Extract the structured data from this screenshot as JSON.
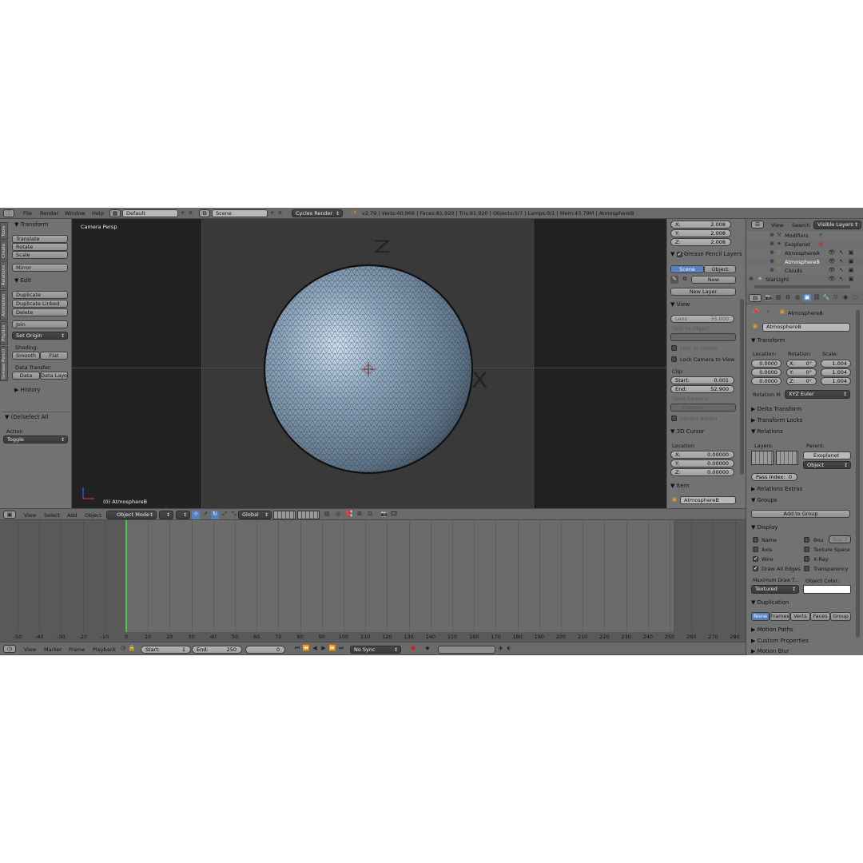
{
  "topbar": {
    "menus": [
      "File",
      "Render",
      "Window",
      "Help"
    ],
    "layout": "Default",
    "scene": "Scene",
    "engine": "Cycles Render",
    "stats": "v2.79 | Verts:40,968 | Faces:81,920 | Tris:81,920 | Objects:0/7 | Lamps:0/1 | Mem:43.79M | AtmosphereB"
  },
  "toolshelf": {
    "tabs": [
      "Tools",
      "Create",
      "Relations",
      "Animation",
      "Physics",
      "Grease Pencil"
    ],
    "transform_title": "Transform",
    "translate": "Translate",
    "rotate": "Rotate",
    "scale": "Scale",
    "mirror": "Mirror",
    "edit_title": "Edit",
    "duplicate": "Duplicate",
    "duplicate_linked": "Duplicate Linked",
    "delete": "Delete",
    "join": "Join",
    "set_origin": "Set Origin",
    "shading_label": "Shading:",
    "smooth": "Smooth",
    "flat": "Flat",
    "data_transfer_label": "Data Transfer:",
    "data": "Data",
    "data_layout": "Data Layo",
    "history": "History",
    "operator_title": "(De)select All",
    "action_label": "Action",
    "action_value": "Toggle"
  },
  "viewport": {
    "label": "Camera Persp",
    "object_label": "(0) AtmosphereB",
    "axis_z": "Z",
    "axis_x": "X"
  },
  "npanel": {
    "loc_x_label": "X:",
    "loc_x": "2.008",
    "loc_y_label": "Y:",
    "loc_y": "2.008",
    "loc_z_label": "Z:",
    "loc_z": "2.008",
    "grease_pencil_title": "Grease Pencil Layers",
    "scene_tab": "Scene",
    "object_tab": "Object",
    "new": "New",
    "new_layer": "New Layer",
    "view_title": "View",
    "lens_label": "Lens",
    "lens": "35.000",
    "lock_to_object": "Lock to Object:",
    "lock_to_cursor": "Lock to Cursor",
    "lock_camera": "Lock Camera to View",
    "clip_label": "Clip:",
    "clip_start_label": "Start:",
    "clip_start": "0.001",
    "clip_end_label": "End:",
    "clip_end": "52.900",
    "local_camera": "Local Camera:",
    "camera": "Camera",
    "render_border": "Render Border",
    "cursor_title": "3D Cursor",
    "location_label": "Location:",
    "cur_x_label": "X:",
    "cur_x": "0.00000",
    "cur_y_label": "Y:",
    "cur_y": "0.00000",
    "cur_z_label": "Z:",
    "cur_z": "0.00000",
    "item_title": "Item",
    "item_name": "AtmosphereB"
  },
  "outliner": {
    "view": "View",
    "search": "Search",
    "filter": "Visible Layers",
    "items": [
      "Modifiers",
      "Exoplanet",
      "AtmosphereA",
      "AtmosphereB",
      "Clouds",
      "StarLight"
    ]
  },
  "properties": {
    "breadcrumb": "AtmosphereB",
    "object_name": "AtmosphereB",
    "transform_title": "Transform",
    "location_label": "Location:",
    "rotation_label": "Rotation:",
    "scale_label": "Scale:",
    "loc": [
      "0.0000",
      "0.0000",
      "0.0000"
    ],
    "rot": [
      "0°",
      "0°",
      "0°"
    ],
    "scl": [
      "1.004",
      "1.004",
      "1.004"
    ],
    "axes": [
      "X:",
      "Y:",
      "Z:"
    ],
    "rotation_mode_label": "Rotation M",
    "rotation_mode": "XYZ Euler",
    "delta_transform": "Delta Transform",
    "transform_locks": "Transform Locks",
    "relations": "Relations",
    "layers_label": "Layers:",
    "parent_label": "Parent:",
    "parent": "Exoplanet",
    "parent_type": "Object",
    "pass_index_label": "Pass Index:",
    "pass_index": "0",
    "relations_extras": "Relations Extras",
    "groups": "Groups",
    "add_to_group": "Add to Group",
    "display": "Display",
    "name": "Name",
    "bounds": "Bou",
    "bounds_type": "Box",
    "axis": "Axis",
    "texture_space": "Texture Space",
    "wire": "Wire",
    "xray": "X-Ray",
    "draw_all_edges": "Draw All Edges",
    "transparency": "Transparency",
    "max_draw_type_label": "Maximum Draw T...",
    "object_color_label": "Object Color:",
    "max_draw_type": "Textured",
    "duplication": "Duplication",
    "dup_options": [
      "None",
      "Frames",
      "Verts",
      "Faces",
      "Group"
    ],
    "motion_paths": "Motion Paths",
    "custom_properties": "Custom Properties",
    "motion_blur": "Motion Blur"
  },
  "view3d_header": {
    "menus": [
      "View",
      "Select",
      "Add",
      "Object"
    ],
    "mode": "Object Mode",
    "orientation": "Global"
  },
  "timeline": {
    "ticks": [
      "-50",
      "-40",
      "-30",
      "-20",
      "-10",
      "0",
      "10",
      "20",
      "30",
      "40",
      "50",
      "60",
      "70",
      "80",
      "90",
      "100",
      "110",
      "120",
      "130",
      "140",
      "150",
      "160",
      "170",
      "180",
      "190",
      "200",
      "210",
      "220",
      "230",
      "240",
      "250",
      "260",
      "270",
      "280"
    ],
    "current_frame": 0,
    "menus": [
      "View",
      "Marker",
      "Frame",
      "Playback"
    ],
    "start_label": "Start:",
    "start": "1",
    "end_label": "End:",
    "end": "250",
    "frame": "0",
    "sync": "No Sync"
  },
  "colors": {
    "selected_blue": "#5680c2",
    "playhead": "#4fc24f",
    "sphere": "#7f95aa"
  }
}
